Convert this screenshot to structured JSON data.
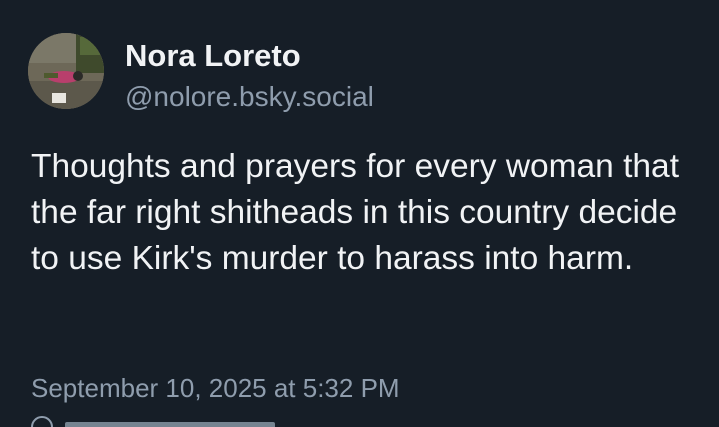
{
  "author": {
    "display_name": "Nora Loreto",
    "handle": "@nolore.bsky.social",
    "avatar_icon": "user-avatar-photo"
  },
  "post": {
    "text": "Thoughts and prayers for every woman that the far right shitheads in this country decide to use Kirk's murder to harass into harm.",
    "timestamp": "September 10, 2025 at 5:32 PM"
  },
  "colors": {
    "background": "#161e27",
    "text_primary": "#f1f3f5",
    "text_secondary": "#8f9dad"
  }
}
